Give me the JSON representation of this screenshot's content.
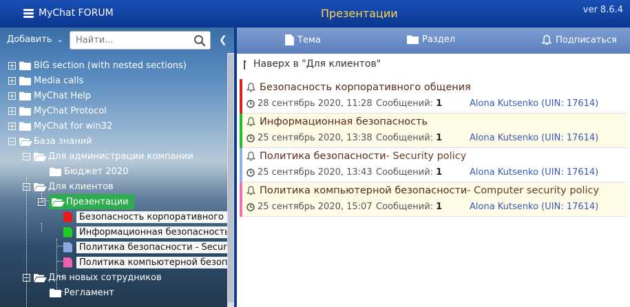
{
  "header": {
    "app_title": "MyChat FORUM",
    "page_title": "Презентации",
    "version": "ver 8.6.4"
  },
  "left_toolbar": {
    "add_label": "Добавить",
    "search_placeholder": "Найти..."
  },
  "tree": {
    "nodes": [
      {
        "label": "BIG section (with nested sections)"
      },
      {
        "label": "Media calls"
      },
      {
        "label": "MyChat Help"
      },
      {
        "label": "MyChat Protocol"
      },
      {
        "label": "MyChat for win32"
      },
      {
        "label": "База знаний"
      },
      {
        "label": "Для администрации компании"
      },
      {
        "label": "Бюджет 2020"
      },
      {
        "label": "Для клиентов"
      },
      {
        "label": "Презентации"
      },
      {
        "label": "Безопасность корпоративного общ"
      },
      {
        "label": "Информационная безопасность"
      },
      {
        "label": "Политика безопасности - Security p"
      },
      {
        "label": "Политика компьютерной безопасн"
      },
      {
        "label": "Для новых сотрудников"
      },
      {
        "label": "Регламент"
      }
    ]
  },
  "right_toolbar": {
    "topic_label": "Тема",
    "section_label": "Раздел",
    "subscribe_label": "Подписаться"
  },
  "back_link": "Наверх в \"Для клиентов\"",
  "topics": [
    {
      "title": "Безопасность корпоративного общения",
      "subtitle": "",
      "date": "28 сентябрь 2020, 11:28",
      "messages_label": "Сообщений:",
      "messages": "1",
      "author": "Alona Kutsenko (UIN: 17614)",
      "color": "#e02020"
    },
    {
      "title": "Информационная безопасность",
      "subtitle": "",
      "date": "25 сентябрь 2020, 13:38",
      "messages_label": "Сообщений:",
      "messages": "1",
      "author": "Alona Kutsenko (UIN: 17614)",
      "color": "#22bb33"
    },
    {
      "title": "Политика безопасности",
      "subtitle": " - Security policy",
      "date": "25 сентябрь 2020, 13:43",
      "messages_label": "Сообщений:",
      "messages": "1",
      "author": "Alona Kutsenko (UIN: 17614)",
      "color": "#8fb0e0"
    },
    {
      "title": "Политика компьютерной безопасности",
      "subtitle": " - Computer security policy",
      "date": "25 сентябрь 2020, 15:07",
      "messages_label": "Сообщений:",
      "messages": "1",
      "author": "Alona Kutsenko (UIN: 17614)",
      "color": "#f070b0"
    }
  ],
  "colors": {
    "selected_node": "#2fab4f",
    "doc_red": "#e81c1c",
    "doc_green": "#22cc22",
    "doc_blue": "#8fa8e0",
    "doc_pink": "#f060b0"
  }
}
